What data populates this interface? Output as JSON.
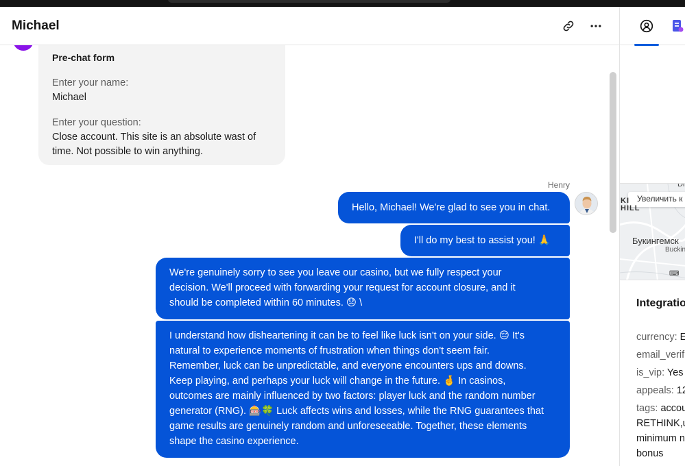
{
  "header": {
    "contact_name": "Michael"
  },
  "prechat_form": {
    "title": "Pre-chat form",
    "name_label": "Enter your name:",
    "name_value": "Michael",
    "question_label": "Enter your question:",
    "question_value_line1": "Close account. This site is an absolute wast of",
    "question_value_line2": "time. Not possible to win anything."
  },
  "agent": {
    "name": "Henry"
  },
  "messages": [
    {
      "lines": [
        "Hello, Michael! We're glad to see you in chat."
      ]
    },
    {
      "lines": [
        "I'll do my best to assist you! 🙏"
      ]
    },
    {
      "lines": [
        "We're genuinely sorry to see you leave our casino, but we fully respect your",
        "decision. We'll proceed with forwarding your request for account closure, and it",
        "should be completed within 60 minutes. 😞 \\"
      ]
    },
    {
      "lines": [
        "I understand how disheartening it can be to feel like luck isn't on your side. 😔 It's",
        "natural to experience moments of frustration when things don't seem fair.",
        "Remember, luck can be unpredictable, and everyone encounters ups and downs.",
        "Keep playing, and perhaps your luck will change in the future. 🤞 In casinos,",
        "outcomes are mainly influenced by two factors: player luck and the random number",
        "generator (RNG). 🎰🍀 Luck affects wins and losses, while the RNG guarantees that",
        "game results are genuinely random and unforeseeable. Together, these elements",
        "shape the casino experience."
      ]
    }
  ],
  "sidebar": {
    "map": {
      "zoom_label": "Увеличить к",
      "hill_line1": "KI",
      "hill_line2": "HILL",
      "place_label": "Букингемск",
      "place_sub": "Buckin",
      "top_fragment": "Di"
    },
    "integration": {
      "title": "Integratio",
      "attrs": [
        {
          "key": "currency:",
          "value": "E"
        },
        {
          "key": "email_verifi",
          "value": ""
        },
        {
          "key": "is_vip:",
          "value": "Yes"
        },
        {
          "key": "appeals:",
          "value": "12"
        },
        {
          "key": "tags:",
          "value": "accou"
        }
      ],
      "tag_lines": [
        "RETHINK,u",
        "minimum n",
        "bonus"
      ]
    }
  },
  "colors": {
    "agent_bubble": "#0554d8",
    "accent": "#0a5bdc",
    "visitor_avatar": "#8a14e8"
  }
}
